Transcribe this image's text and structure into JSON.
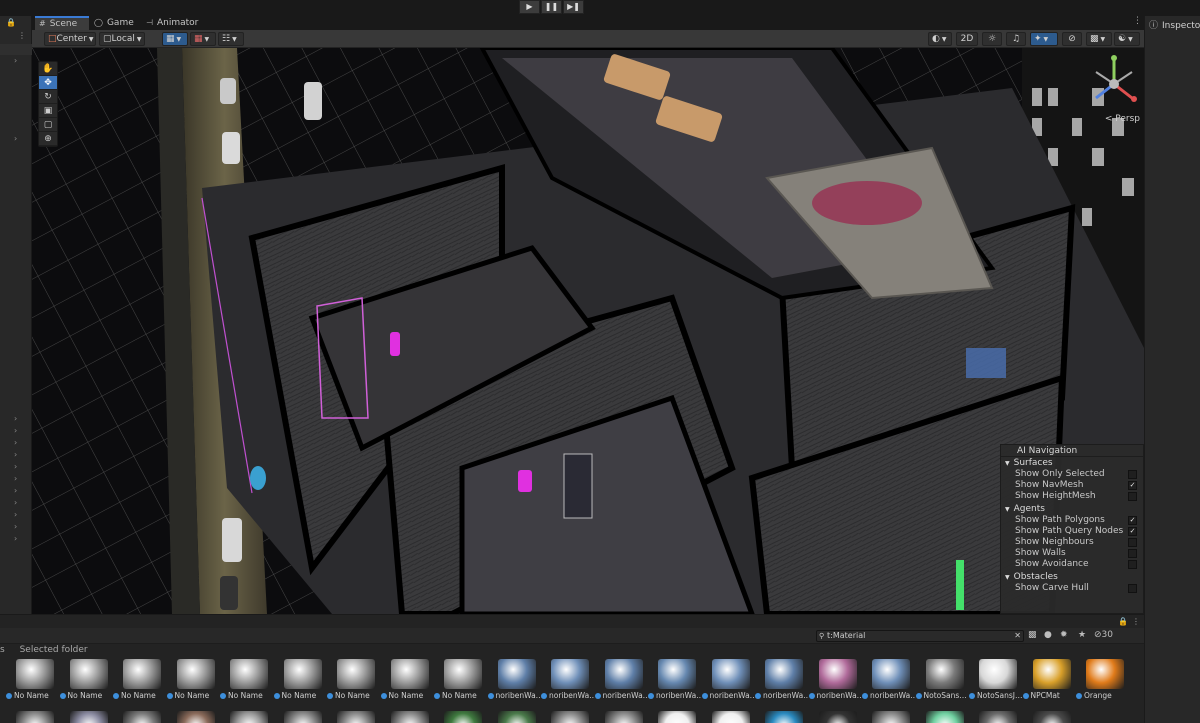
{
  "toolbar_top": {
    "play_icon": "play-icon",
    "pause_icon": "pause-icon",
    "step_icon": "step-icon"
  },
  "tabs": [
    {
      "label": "Scene",
      "icon": "hash-icon",
      "active": true
    },
    {
      "label": "Game",
      "icon": "gamepad-icon",
      "active": false
    },
    {
      "label": "Animator",
      "icon": "animator-icon",
      "active": false
    }
  ],
  "scene_toolbar": {
    "pivot": "Center",
    "space": "Local",
    "mode_2d": "2D"
  },
  "tools": [
    "hand-icon",
    "move-icon",
    "rotate-icon",
    "scale-icon",
    "rect-icon",
    "transform-icon"
  ],
  "gizmo": {
    "label": "< Persp"
  },
  "ai_navigation": {
    "title": "AI Navigation",
    "surfaces": {
      "label": "Surfaces",
      "items": [
        {
          "label": "Show Only Selected",
          "checked": false
        },
        {
          "label": "Show NavMesh",
          "checked": true
        },
        {
          "label": "Show HeightMesh",
          "checked": false
        }
      ]
    },
    "agents": {
      "label": "Agents",
      "items": [
        {
          "label": "Show Path Polygons",
          "checked": true
        },
        {
          "label": "Show Path Query Nodes",
          "checked": true
        },
        {
          "label": "Show Neighbours",
          "checked": false
        },
        {
          "label": "Show Walls",
          "checked": false
        },
        {
          "label": "Show Avoidance",
          "checked": false
        }
      ]
    },
    "obstacles": {
      "label": "Obstacles",
      "items": [
        {
          "label": "Show Carve Hull",
          "checked": false
        }
      ]
    }
  },
  "inspector": {
    "label": "Inspector"
  },
  "project": {
    "search": "t:Material",
    "breadcrumb_prefix": "s",
    "breadcrumb": "Selected folder",
    "hidden_count": "30",
    "assets": [
      {
        "name": "No Name",
        "color": "#9a9a9a"
      },
      {
        "name": "No Name",
        "color": "#9a9a9a"
      },
      {
        "name": "No Name",
        "color": "#9a9a9a"
      },
      {
        "name": "No Name",
        "color": "#9a9a9a"
      },
      {
        "name": "No Name",
        "color": "#9a9a9a"
      },
      {
        "name": "No Name",
        "color": "#9a9a9a"
      },
      {
        "name": "No Name",
        "color": "#9a9a9a"
      },
      {
        "name": "No Name",
        "color": "#9a9a9a"
      },
      {
        "name": "No Name",
        "color": "#9a9a9a"
      },
      {
        "name": "noribenWa…",
        "color": "#5f7fa8"
      },
      {
        "name": "noribenWa…",
        "color": "#6f8fb8"
      },
      {
        "name": "noribenWa…",
        "color": "#5f7fa8"
      },
      {
        "name": "noribenWa…",
        "color": "#6688b0"
      },
      {
        "name": "noribenWa…",
        "color": "#6f8fb8"
      },
      {
        "name": "noribenWa…",
        "color": "#5f7fa8"
      },
      {
        "name": "noribenWa…",
        "color": "#b06a9a"
      },
      {
        "name": "noribenWa…",
        "color": "#6f8fb8"
      },
      {
        "name": "NotoSans…",
        "color": "#7a7a7a"
      },
      {
        "name": "NotoSansJ…",
        "color": "#d8d8d8"
      },
      {
        "name": "NPCMat",
        "color": "#d9a02a"
      },
      {
        "name": "Orange",
        "color": "#e07b1a"
      }
    ],
    "row2_colors": [
      "#8a8a8a",
      "#8a8aa0",
      "#7a7a7a",
      "#8a6a5a",
      "#9a9a9a",
      "#8a8a8a",
      "#8a8a8a",
      "#8a8a8a",
      "#3f7a3f",
      "#4a7a4a",
      "#8a8a8a",
      "#8a8a8a",
      "#f0f0f0",
      "#f0f0f0",
      "#2a8ac0",
      "#333333",
      "#8a8a8a",
      "#6fd0a0",
      "#6a6a6a",
      "#4a4a4a"
    ]
  }
}
